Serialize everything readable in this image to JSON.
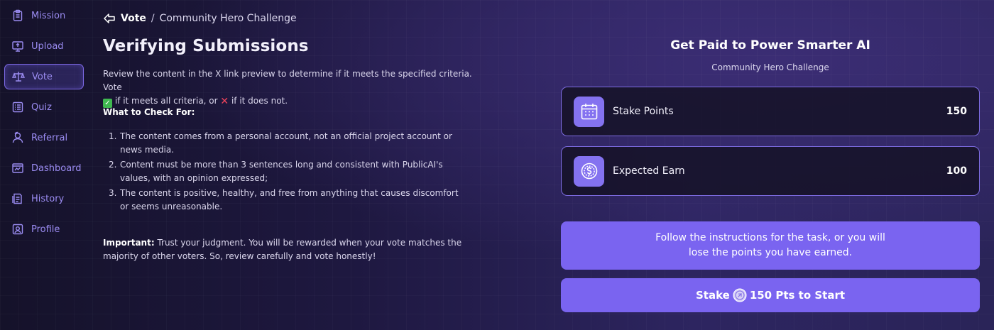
{
  "sidebar": {
    "items": [
      {
        "label": "Mission",
        "icon": "clipboard-icon"
      },
      {
        "label": "Upload",
        "icon": "monitor-upload-icon"
      },
      {
        "label": "Vote",
        "icon": "scale-icon",
        "active": true
      },
      {
        "label": "Quiz",
        "icon": "list-icon"
      },
      {
        "label": "Referral",
        "icon": "user-icon"
      },
      {
        "label": "Dashboard",
        "icon": "dashboard-icon"
      },
      {
        "label": "History",
        "icon": "history-icon"
      },
      {
        "label": "Profile",
        "icon": "profile-icon"
      }
    ]
  },
  "breadcrumb": {
    "root": "Vote",
    "separator": "/",
    "current": "Community Hero Challenge"
  },
  "page_title": "Verifying Submissions",
  "intro": {
    "part1": "Review the content in the X link preview to determine if it meets the specified criteria. Vote",
    "part2": " if it meets all criteria, or ",
    "part3": " if it does not."
  },
  "check": {
    "heading": "What to Check For:",
    "items": [
      {
        "num": "1.",
        "text": "The content comes from a personal account, not an official project account or news media."
      },
      {
        "num": "2.",
        "text": "Content must be more than 3 sentences long and consistent with PublicAI's values, with an opinion expressed;"
      },
      {
        "num": "3.",
        "text": "The content is positive, healthy, and free from anything that causes discomfort or seems unreasonable."
      }
    ]
  },
  "important": {
    "label": "Important:",
    "text": " Trust your judgment. You will be rewarded when your vote matches the majority of other voters. So, review carefully and vote honestly!"
  },
  "panel": {
    "title": "Get Paid to Power Smarter AI",
    "subtitle": "Community Hero Challenge",
    "stake": {
      "label": "Stake Points",
      "value": "150"
    },
    "earn": {
      "label": "Expected Earn",
      "value": "100"
    },
    "notice": "Follow the instructions for the task, or you will lose the points you have earned.",
    "button": {
      "prefix": "Stake",
      "suffix": "150 Pts to Start"
    }
  },
  "colors": {
    "accent": "#7a64f0",
    "card_border": "#7c6be0",
    "sidebar_text": "#9b8cf2"
  }
}
